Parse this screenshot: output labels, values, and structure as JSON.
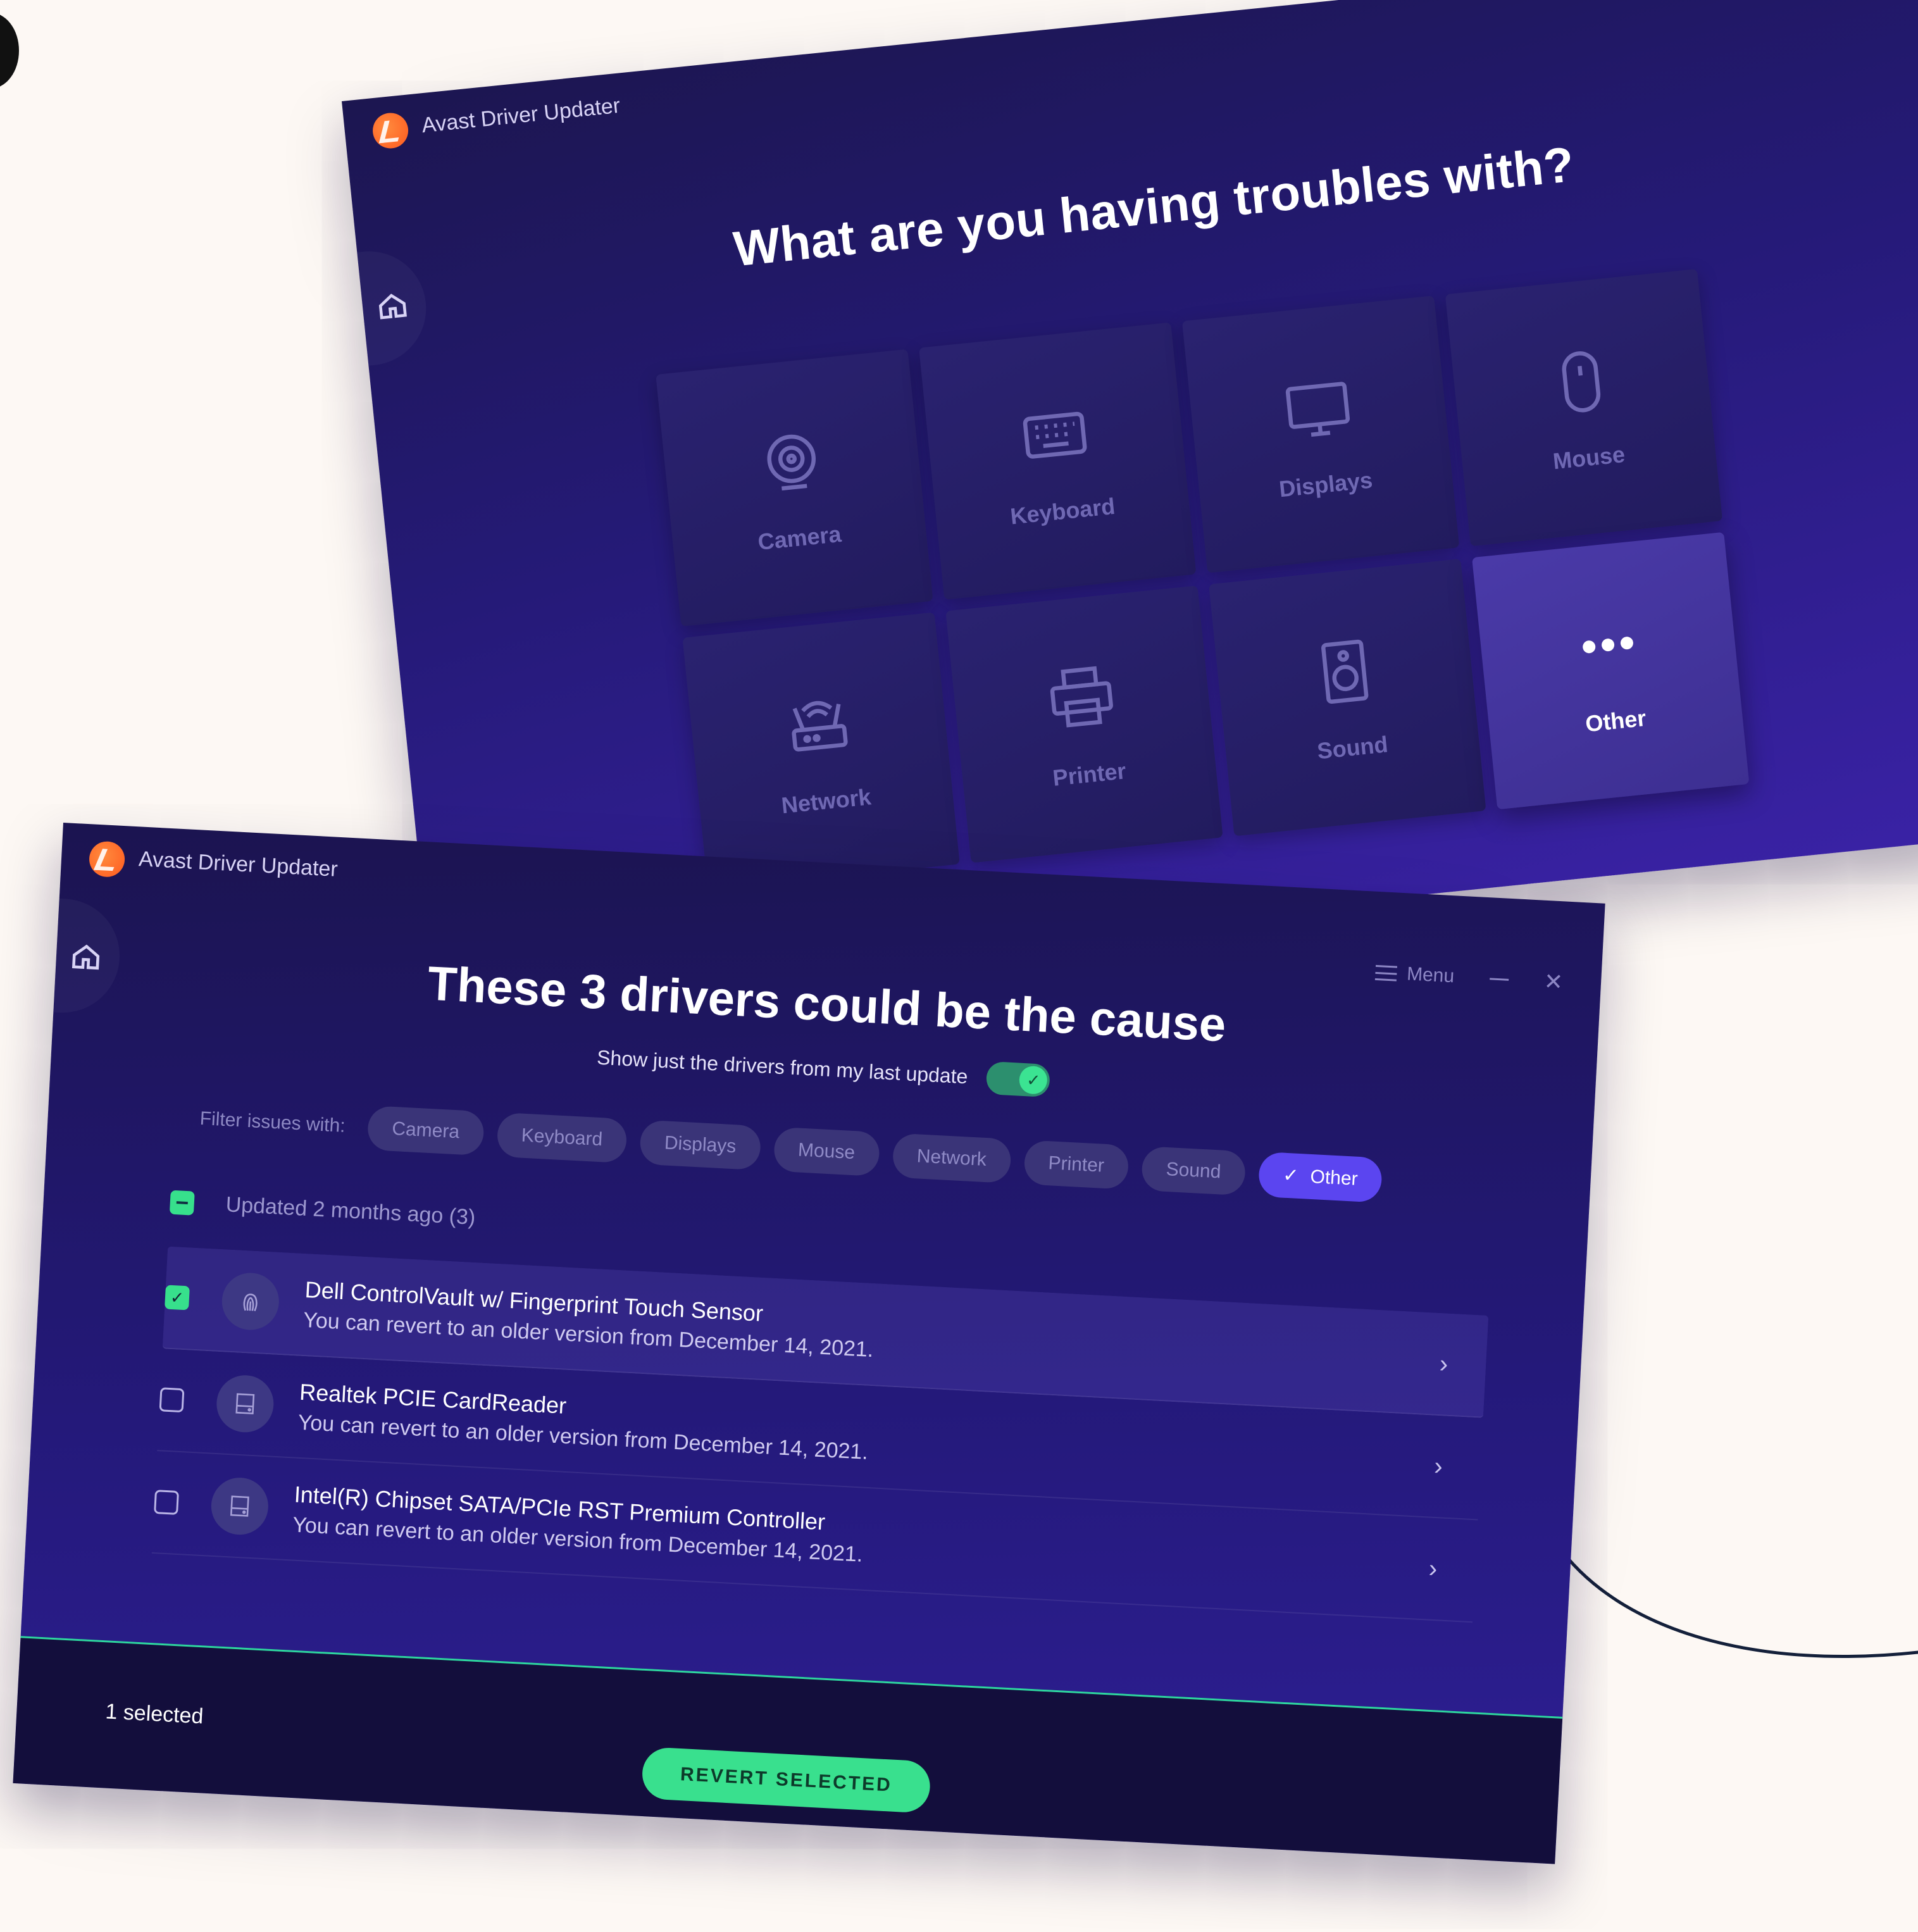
{
  "app": {
    "title": "Avast Driver Updater",
    "menu_label": "Menu",
    "accent_color": "#5b45f0",
    "success_color": "#39e08e",
    "logo_color": "#ff6a2a"
  },
  "troubles_screen": {
    "heading": "What are you having troubles with?",
    "categories": [
      {
        "label": "Camera",
        "icon": "camera-icon"
      },
      {
        "label": "Keyboard",
        "icon": "keyboard-icon"
      },
      {
        "label": "Displays",
        "icon": "display-icon"
      },
      {
        "label": "Mouse",
        "icon": "mouse-icon"
      },
      {
        "label": "Network",
        "icon": "router-icon"
      },
      {
        "label": "Printer",
        "icon": "printer-icon"
      },
      {
        "label": "Sound",
        "icon": "speaker-icon"
      },
      {
        "label": "Other",
        "icon": "more-dots-icon",
        "selected": true
      }
    ]
  },
  "drivers_screen": {
    "heading": "These 3 drivers could be the cause",
    "toggle_label": "Show just the drivers from my last update",
    "toggle_on": true,
    "filter_label": "Filter issues with:",
    "filters": [
      {
        "label": "Camera",
        "active": false
      },
      {
        "label": "Keyboard",
        "active": false
      },
      {
        "label": "Displays",
        "active": false
      },
      {
        "label": "Mouse",
        "active": false
      },
      {
        "label": "Network",
        "active": false
      },
      {
        "label": "Printer",
        "active": false
      },
      {
        "label": "Sound",
        "active": false
      },
      {
        "label": "Other",
        "active": true
      }
    ],
    "group_label": "Updated 2 months ago (3)",
    "drivers": [
      {
        "name": "Dell ControlVault w/ Fingerprint Touch Sensor",
        "subtitle": "You can revert to an older version from December 14, 2021.",
        "checked": true,
        "icon": "fingerprint-icon"
      },
      {
        "name": "Realtek PCIE CardReader",
        "subtitle": "You can revert to an older version from December 14, 2021.",
        "checked": false,
        "icon": "drive-icon"
      },
      {
        "name": "Intel(R) Chipset SATA/PCIe RST Premium Controller",
        "subtitle": "You can revert to an older version from December 14, 2021.",
        "checked": false,
        "icon": "drive-icon"
      }
    ],
    "selected_count": "1 selected",
    "revert_button": "REVERT SELECTED"
  }
}
